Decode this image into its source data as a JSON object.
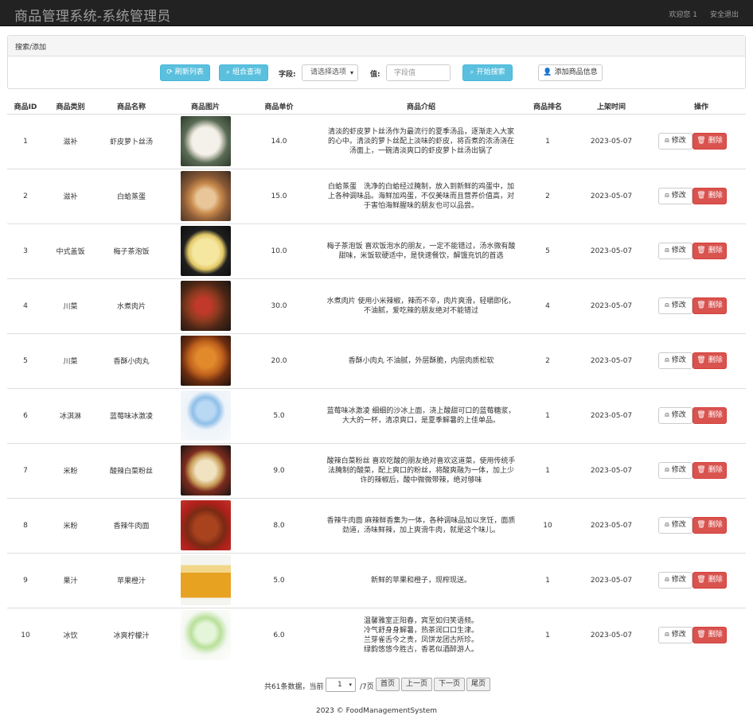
{
  "header": {
    "title": "商品管理系统-系统管理员",
    "welcome": "欢迎您 1",
    "logout": "安全退出"
  },
  "search": {
    "panel_title": "搜索/添加",
    "refresh_label": "刷新列表",
    "combo_query_label": "组合查询",
    "field_label": "字段:",
    "field_select": "请选择选项",
    "value_label": "值:",
    "value_placeholder": "字段值",
    "start_search_label": "开始搜索",
    "add_label": "添加商品信息"
  },
  "table": {
    "headers": [
      "商品ID",
      "商品类别",
      "商品名称",
      "商品图片",
      "商品单价",
      "商品介绍",
      "商品排名",
      "上架时间",
      "操作"
    ],
    "edit_label": "修改",
    "delete_label": "删除",
    "rows": [
      {
        "id": "1",
        "category": "滋补",
        "name": "虾皮萝卜丝汤",
        "image": "soup-bowl",
        "price": "14.0",
        "desc": "清淡的虾皮萝卜丝汤作为最流行的夏季汤品，逐渐走入大家的心中。清淡的萝卜丝配上淡味的虾皮，将百煮的浓汤浇在汤面上，一碗清淡爽口的虾皮萝卜丝汤出锅了",
        "rank": "1",
        "date": "2023-05-07"
      },
      {
        "id": "2",
        "category": "滋补",
        "name": "白蛤蒸蛋",
        "image": "clam-egg",
        "price": "15.0",
        "desc": "白蛤蒸蛋　洗净的白蛤经过腌制，放入到新鲜的鸡蛋中，加上各种调味品。海鲜加鸡蛋，不仅美味而且营养价值高，对于害怕海鲜腥味的朋友也可以品尝。",
        "rank": "2",
        "date": "2023-05-07"
      },
      {
        "id": "3",
        "category": "中式盖饭",
        "name": "梅子茶泡饭",
        "image": "rice-bowl",
        "price": "10.0",
        "desc": "梅子茶泡饭 喜欢饭泡水的朋友，一定不能错过，汤水微有酸甜味，米饭软硬适中，是快速餐饮，解饿充饥的首选",
        "rank": "5",
        "date": "2023-05-07"
      },
      {
        "id": "4",
        "category": "川菜",
        "name": "水煮肉片",
        "image": "spicy-meat",
        "price": "30.0",
        "desc": "水煮肉片 使用小米辣椒，辣而不辛，肉片爽滑，轻嚼即化，不油腻，爱吃辣的朋友绝对不能错过",
        "rank": "4",
        "date": "2023-05-07"
      },
      {
        "id": "5",
        "category": "川菜",
        "name": "香酥小肉丸",
        "image": "meatballs",
        "price": "20.0",
        "desc": "香酥小肉丸 不油腻，外层酥脆，内层肉质松软",
        "rank": "2",
        "date": "2023-05-07"
      },
      {
        "id": "6",
        "category": "冰淇淋",
        "name": "蓝莓味冰激凌",
        "image": "shaved-ice",
        "price": "5.0",
        "desc": "蓝莓味冰激凌 细细的沙冰上面，浇上酸甜可口的蓝莓糖浆，大大的一杯，清凉爽口，是夏季解暑的上佳单品。",
        "rank": "1",
        "date": "2023-05-07"
      },
      {
        "id": "7",
        "category": "米粉",
        "name": "酸辣白菜粉丝",
        "image": "noodles",
        "price": "9.0",
        "desc": "酸辣白菜粉丝 喜欢吃酸的朋友绝对喜欢这道菜，使用传统手法腌制的酸菜，配上爽口的粉丝，将酸爽融为一体，加上少许的辣椒后，酸中微微带辣，绝对够味",
        "rank": "1",
        "date": "2023-05-07"
      },
      {
        "id": "8",
        "category": "米粉",
        "name": "香辣牛肉面",
        "image": "beef-noodle",
        "price": "8.0",
        "desc": "香辣牛肉面 麻辣鲜香集为一体，各种调味品加以烹饪，面质劲道，汤味鲜辣，加上爽滑牛肉，就是这个味儿。",
        "rank": "10",
        "date": "2023-05-07"
      },
      {
        "id": "9",
        "category": "果汁",
        "name": "苹果橙汁",
        "image": "juice-bottle",
        "price": "5.0",
        "desc": "新鲜的苹果和橙子，现榨现送。",
        "rank": "1",
        "date": "2023-05-07"
      },
      {
        "id": "10",
        "category": "冰饮",
        "name": "冰爽柠檬汁",
        "image": "lemon-drink",
        "price": "6.0",
        "desc": "温馨雅室正阳春，宾至如归笑语频。\n冷气舒身身解暑，热茶润口口生津。\n兰芽雀舌今之贵，凤饼龙团古所珍。\n绿韵悠悠今胜古，香茗似酒醉游人。",
        "rank": "1",
        "date": "2023-05-07"
      }
    ]
  },
  "pager": {
    "summary": "共61条数据，当前",
    "current_page": "1",
    "total": "/7页",
    "first": "首页",
    "prev": "上一页",
    "next": "下一页",
    "last": "尾页"
  },
  "footer": {
    "copyright": "2023 © FoodManagementSystem"
  },
  "colors": {
    "navbar": "#222222",
    "info": "#5bc0de",
    "danger": "#d9534f"
  }
}
